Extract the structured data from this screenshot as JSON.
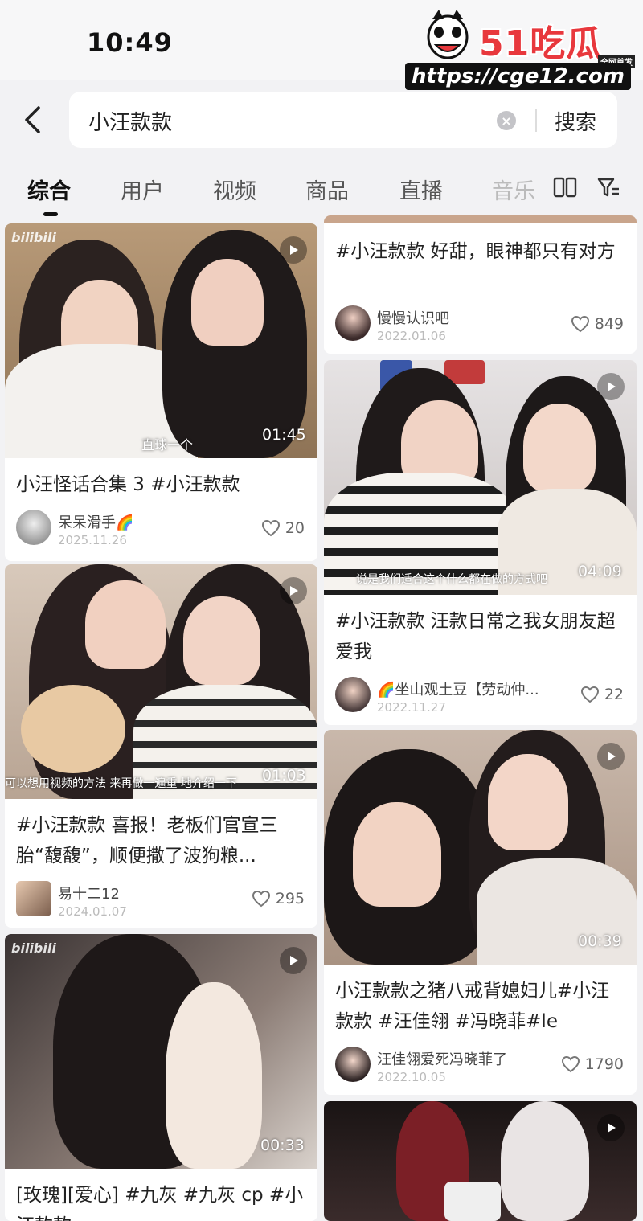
{
  "status": {
    "time": "10:49"
  },
  "watermark": {
    "logo": "51吃瓜",
    "badge": "全网首发",
    "url": "https://cge12.com"
  },
  "search": {
    "query": "小汪款款",
    "button": "搜索"
  },
  "tabs": [
    {
      "label": "综合",
      "active": true
    },
    {
      "label": "用户"
    },
    {
      "label": "视频"
    },
    {
      "label": "商品"
    },
    {
      "label": "直播"
    },
    {
      "label": "音乐"
    }
  ],
  "icons": {
    "back": "chevron-left-icon",
    "clear": "clear-icon",
    "layout": "grid-view-icon",
    "filter": "filter-icon",
    "like": "heart-icon",
    "play": "play-icon"
  },
  "cards": {
    "left": [
      {
        "title": "小汪怪话合集 3 #小汪款款",
        "author": "呆呆滑手🌈",
        "date": "2025.11.26",
        "likes": "20",
        "duration": "01:45",
        "caption": "直球一个",
        "brand": "bilibili"
      },
      {
        "title": "#小汪款款 喜报！老板们官宣三胎“馥馥”，顺便撒了波狗粮...",
        "author": "易十二12",
        "date": "2024.01.07",
        "likes": "295",
        "duration": "01:03",
        "caption": "可以想用视频的方法 来再做一遍重 地介绍一下"
      },
      {
        "title": "[玫瑰][爱心] #九灰 #九灰 cp #小汪款款",
        "duration": "00:33",
        "brand": "bilibili"
      }
    ],
    "right": [
      {
        "title": "#小汪款款 好甜，眼神都只有对方",
        "author": "慢慢认识吧",
        "date": "2022.01.06",
        "likes": "849"
      },
      {
        "title": "#小汪款款 汪款日常之我女朋友超爱我",
        "author": "🌈坐山观土豆【劳动仲...",
        "date": "2022.11.27",
        "likes": "22",
        "duration": "04:09",
        "caption": "说是我们适合这个什么都在做的方式吧"
      },
      {
        "title": "小汪款款之猪八戒背媳妇儿#小汪款款 #汪佳翎 #冯晓菲#le",
        "author": "汪佳翎爱死冯晓菲了",
        "date": "2022.10.05",
        "likes": "1790",
        "duration": "00:39"
      },
      {
        "title": ""
      }
    ]
  }
}
